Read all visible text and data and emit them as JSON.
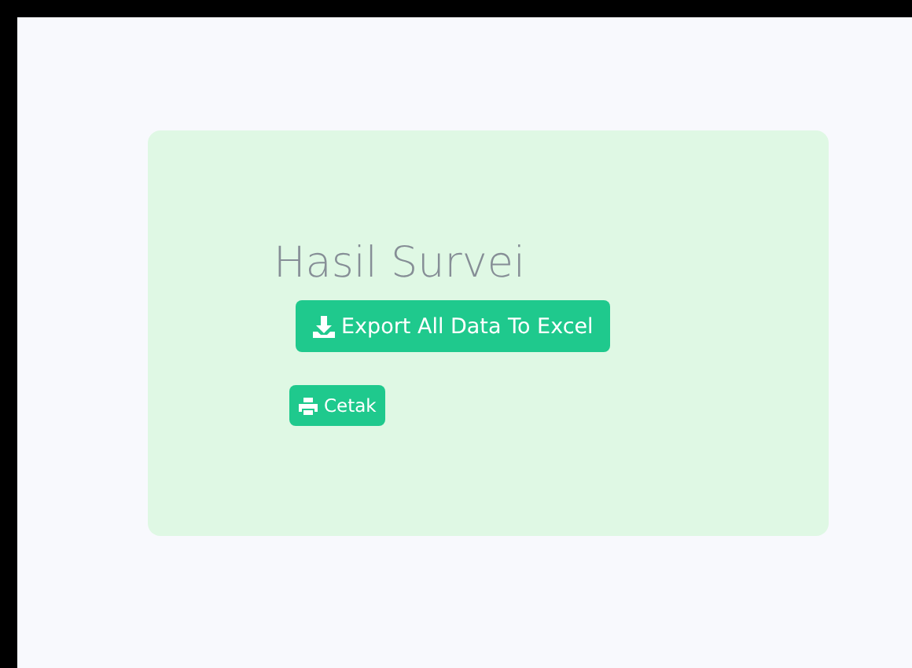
{
  "card": {
    "title": "Hasil Survei",
    "buttons": [
      {
        "kind": "download",
        "label": "Export All Data To Excel"
      },
      {
        "kind": "print",
        "label": "Cetak"
      }
    ]
  }
}
